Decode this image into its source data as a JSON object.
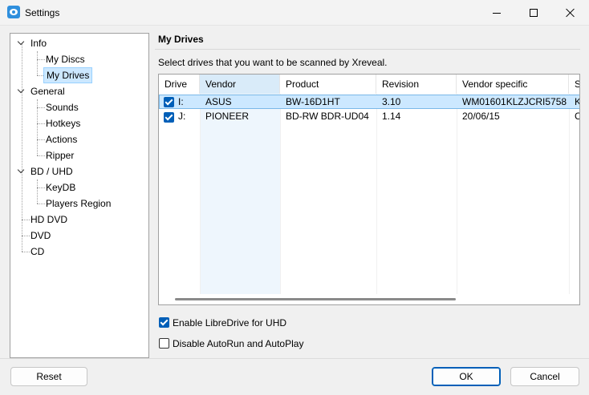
{
  "window": {
    "title": "Settings",
    "icon": "eye-icon"
  },
  "tree": {
    "items": [
      {
        "label": "Info"
      },
      {
        "label": "My Discs"
      },
      {
        "label": "My Drives"
      },
      {
        "label": "General"
      },
      {
        "label": "Sounds"
      },
      {
        "label": "Hotkeys"
      },
      {
        "label": "Actions"
      },
      {
        "label": "Ripper"
      },
      {
        "label": "BD / UHD"
      },
      {
        "label": "KeyDB"
      },
      {
        "label": "Players Region"
      },
      {
        "label": "HD DVD"
      },
      {
        "label": "DVD"
      },
      {
        "label": "CD"
      }
    ],
    "selected": "My Drives"
  },
  "main": {
    "title": "My Drives",
    "description": "Select drives that you want to be scanned by Xreveal."
  },
  "drives": {
    "columns": [
      "Drive",
      "Vendor",
      "Product",
      "Revision",
      "Vendor specific",
      "S"
    ],
    "sorted_column": "Vendor",
    "rows": [
      {
        "checked": true,
        "drive": "I:",
        "vendor": "ASUS",
        "product": "BW-16D1HT",
        "revision": "3.10",
        "vendor_specific": "WM01601KLZJCRI5758",
        "s": "K"
      },
      {
        "checked": true,
        "drive": "J:",
        "vendor": "PIONEER",
        "product": "BD-RW BDR-UD04",
        "revision": "1.14",
        "vendor_specific": "20/06/15",
        "s": "C"
      }
    ]
  },
  "options": {
    "libredrive": {
      "label": "Enable LibreDrive for UHD",
      "checked": true
    },
    "autorun": {
      "label": "Disable AutoRun and AutoPlay",
      "checked": false
    }
  },
  "buttons": {
    "reset": "Reset",
    "ok": "OK",
    "cancel": "Cancel"
  },
  "colors": {
    "accent": "#005fb8",
    "selection": "#cce8ff"
  }
}
